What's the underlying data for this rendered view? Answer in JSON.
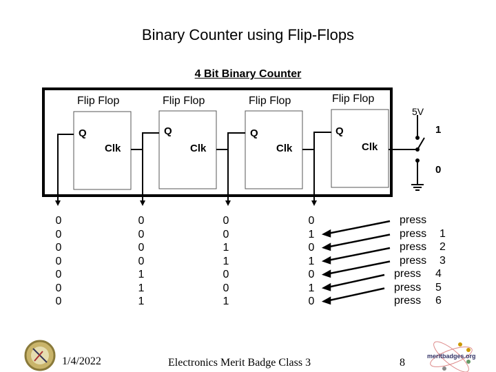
{
  "title": "Binary Counter using Flip-Flops",
  "subtitle": "4 Bit Binary Counter",
  "flip_flops": [
    {
      "label": "Flip Flop",
      "q": "Q",
      "clk": "Clk"
    },
    {
      "label": "Flip Flop",
      "q": "Q",
      "clk": "Clk"
    },
    {
      "label": "Flip Flop",
      "q": "Q",
      "clk": "Clk"
    },
    {
      "label": "Flip Flop",
      "q": "Q",
      "clk": "Clk"
    }
  ],
  "switch": {
    "supply": "5V",
    "high": "1",
    "low": "0"
  },
  "columns": [
    [
      "0",
      "0",
      "0",
      "0",
      "0",
      "0",
      "0"
    ],
    [
      "0",
      "0",
      "0",
      "0",
      "1",
      "1",
      "1"
    ],
    [
      "0",
      "0",
      "1",
      "1",
      "0",
      "0",
      "1"
    ],
    [
      "0",
      "1",
      "0",
      "1",
      "0",
      "1",
      "0"
    ]
  ],
  "presses": [
    {
      "word": "press",
      "n": ""
    },
    {
      "word": "press",
      "n": "1"
    },
    {
      "word": "press",
      "n": "2"
    },
    {
      "word": "press",
      "n": "3"
    },
    {
      "word": "press",
      "n": "4"
    },
    {
      "word": "press",
      "n": "5"
    },
    {
      "word": "press",
      "n": "6"
    }
  ],
  "footer": {
    "date": "1/4/2022",
    "center": "Electronics Merit Badge Class 3",
    "page": "8",
    "logo_text": "meritbadges.org"
  }
}
